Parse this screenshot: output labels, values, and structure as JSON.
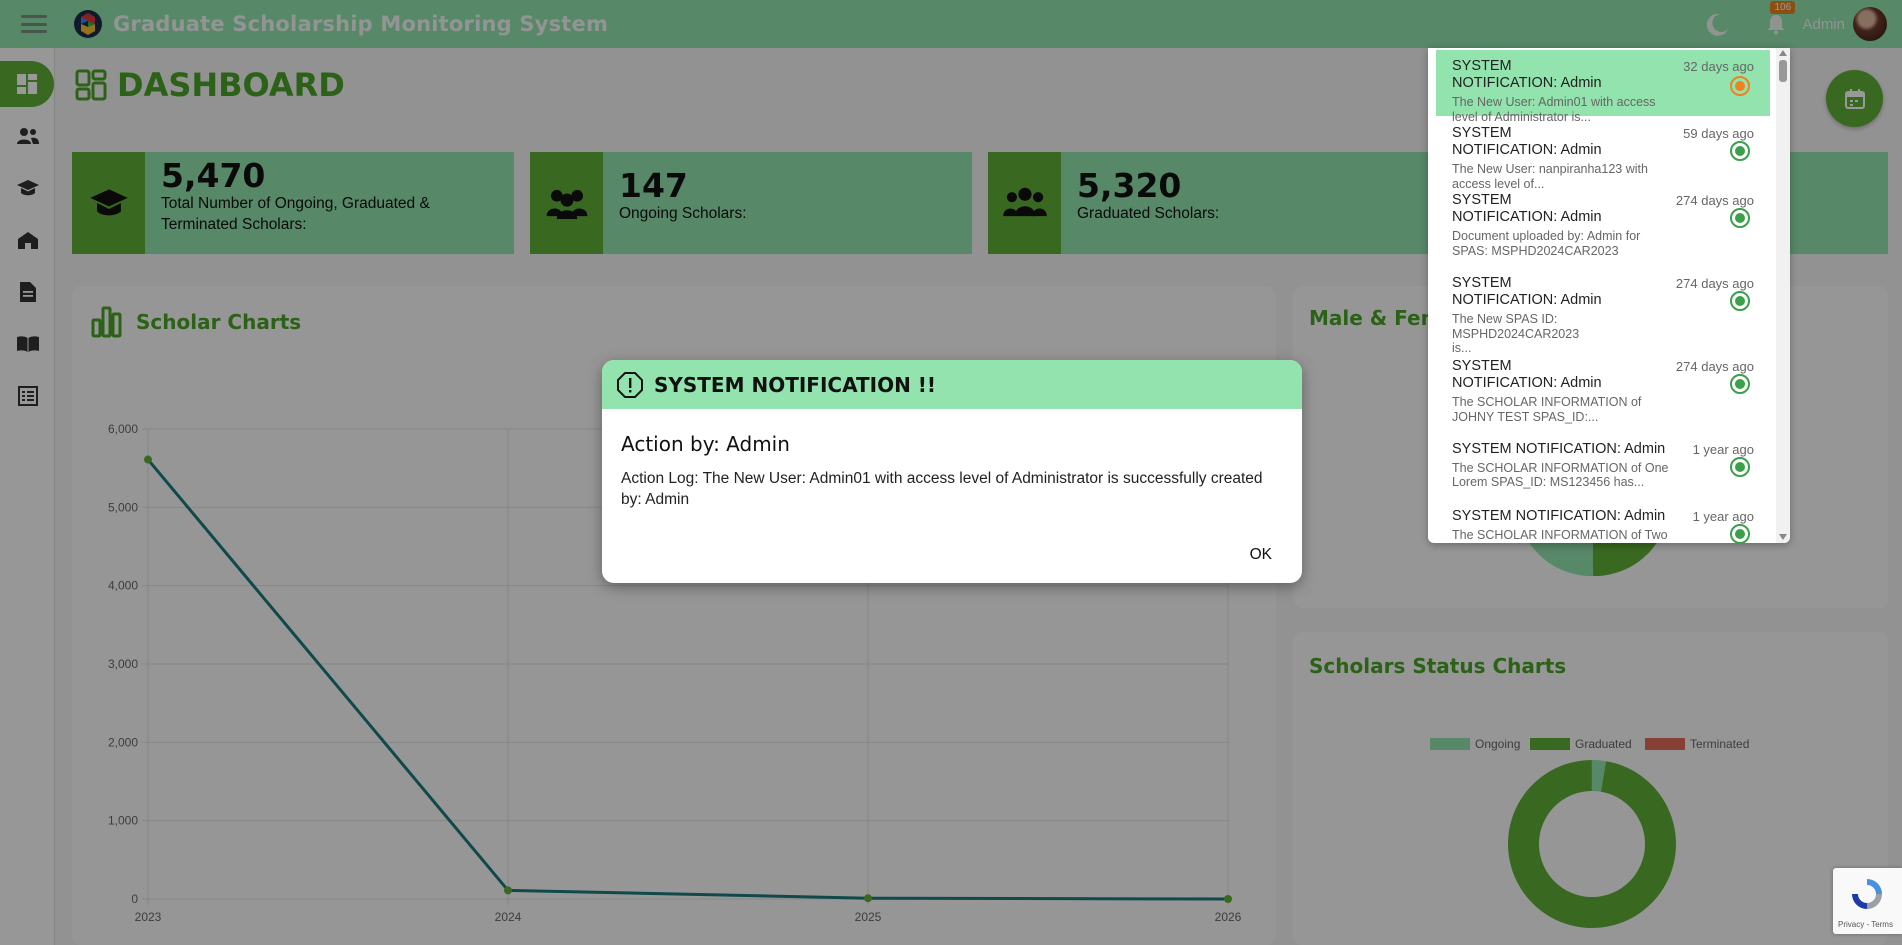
{
  "app": {
    "title": "Graduate Scholarship Monitoring System",
    "brand_color": "#5fb037",
    "accent_color": "#92e3ad"
  },
  "header": {
    "notifications_count": "106",
    "user_name": "Admin"
  },
  "sidebar": {
    "items": [
      {
        "icon": "dashboard-icon",
        "active": true
      },
      {
        "icon": "users-icon",
        "active": false
      },
      {
        "icon": "graduation-cap-icon",
        "active": false
      },
      {
        "icon": "school-icon",
        "active": false
      },
      {
        "icon": "document-icon",
        "active": false
      },
      {
        "icon": "book-open-icon",
        "active": false
      },
      {
        "icon": "list-icon",
        "active": false
      }
    ]
  },
  "page": {
    "title": "DASHBOARD"
  },
  "stats": [
    {
      "value": "5,470",
      "label": "Total Number of Ongoing, Graduated & Terminated Scholars:",
      "icon": "graduation-cap-icon"
    },
    {
      "value": "147",
      "label": "Ongoing Scholars:",
      "icon": "users-group-icon"
    },
    {
      "value": "5,320",
      "label": "Graduated Scholars:",
      "icon": "users-group-icon"
    }
  ],
  "panels": {
    "scholar_charts_title": "Scholar Charts",
    "male_female_title": "Male & Fem",
    "status_charts_title": "Scholars Status Charts"
  },
  "chart_data": [
    {
      "type": "line",
      "title": "Scholar Charts",
      "categories": [
        "2023",
        "2024",
        "2025",
        "2026"
      ],
      "values": [
        5610,
        110,
        10,
        0
      ],
      "ylim": [
        0,
        6000
      ],
      "yticks": [
        "0",
        "1,000",
        "2,000",
        "3,000",
        "4,000",
        "5,000",
        "6,000"
      ],
      "color": "#1a7b7b",
      "grid": true
    },
    {
      "type": "pie",
      "title": "Scholars Status Charts",
      "legend": [
        "Ongoing",
        "Graduated",
        "Terminated"
      ],
      "values": [
        147,
        5320,
        3
      ],
      "colors": [
        "#92e3ad",
        "#5fb037",
        "#e06c5a"
      ],
      "legend_position": "top"
    }
  ],
  "notifications": [
    {
      "title": "SYSTEM NOTIFICATION: Admin",
      "time": "32 days ago",
      "text": "The New User: Admin01 with access level of Administrator is...",
      "unread": true
    },
    {
      "title": "SYSTEM NOTIFICATION: Admin",
      "time": "59 days ago",
      "text": "The New User: nanpiranha123 with access level of...",
      "unread": false
    },
    {
      "title": "SYSTEM NOTIFICATION: Admin",
      "time": "274 days ago",
      "text": "Document uploaded by: Admin for SPAS: MSPHD2024CAR2023",
      "unread": false
    },
    {
      "title": "SYSTEM NOTIFICATION: Admin",
      "time": "274 days ago",
      "text": "The New SPAS ID: MSPHD2024CAR2023 is...",
      "unread": false
    },
    {
      "title": "SYSTEM NOTIFICATION: Admin",
      "time": "274 days ago",
      "text": "The SCHOLAR INFORMATION of JOHNY TEST SPAS_ID:...",
      "unread": false
    },
    {
      "title": "SYSTEM NOTIFICATION: Admin",
      "time": "1 year ago",
      "text": "The SCHOLAR INFORMATION of One Lorem SPAS_ID: MS123456 has...",
      "unread": false
    },
    {
      "title": "SYSTEM NOTIFICATION: Admin",
      "time": "1 year ago",
      "text": "The SCHOLAR INFORMATION of Two",
      "unread": false
    }
  ],
  "modal": {
    "title": "SYSTEM NOTIFICATION !!",
    "action_by": "Action by: Admin",
    "log": "Action Log: The New User: Admin01 with access level of Administrator is successfully created by: Admin",
    "ok_label": "OK"
  },
  "recaptcha": {
    "text": "Privacy - Terms"
  }
}
